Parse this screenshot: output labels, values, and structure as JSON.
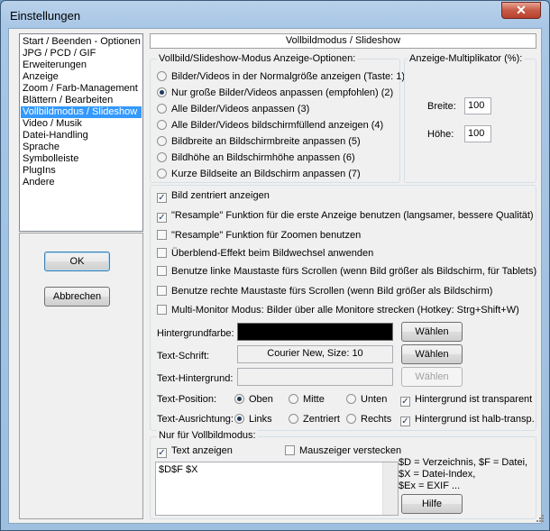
{
  "window": {
    "title": "Einstellungen",
    "close": "✕"
  },
  "nav": {
    "items": [
      "Start / Beenden - Optionen",
      "JPG / PCD / GIF",
      "Erweiterungen",
      "Anzeige",
      "Zoom / Farb-Management",
      "Blättern / Bearbeiten",
      "Vollbildmodus / Slideshow",
      "Video / Musik",
      "Datei-Handling",
      "Sprache",
      "Symbolleiste",
      "PlugIns",
      "Andere"
    ],
    "selected_index": 6
  },
  "buttons": {
    "ok": "OK",
    "cancel": "Abbrechen",
    "help": "Hilfe",
    "choose": "Wählen"
  },
  "header": "Vollbildmodus / Slideshow",
  "display_mode": {
    "label": "Vollbild/Slideshow-Modus Anzeige-Optionen:",
    "options": [
      "Bilder/Videos in der Normalgröße anzeigen (Taste: 1)",
      "Nur große Bilder/Videos anpassen (empfohlen) (2)",
      "Alle Bilder/Videos anpassen (3)",
      "Alle Bilder/Videos bildschirmfüllend anzeigen (4)",
      "Bildbreite an Bildschirmbreite anpassen (5)",
      "Bildhöhe an Bildschirmhöhe anpassen (6)",
      "Kurze Bildseite an Bildschirm anpassen (7)"
    ],
    "selected_index": 1
  },
  "multiplier": {
    "label": "Anzeige-Multiplikator (%):",
    "width_label": "Breite:",
    "width_value": "100",
    "height_label": "Höhe:",
    "height_value": "100"
  },
  "checkboxes": [
    {
      "label": "Bild zentriert anzeigen",
      "checked": true
    },
    {
      "label": "\"Resample\" Funktion für die erste Anzeige benutzen (langsamer, bessere Qualität)",
      "checked": true
    },
    {
      "label": "\"Resample\" Funktion für Zoomen benutzen",
      "checked": false
    },
    {
      "label": "Überblend-Effekt beim Bildwechsel anwenden",
      "checked": false
    },
    {
      "label": "Benutze linke Maustaste fürs Scrollen (wenn Bild größer als Bildschirm, für Tablets)",
      "checked": false
    },
    {
      "label": "Benutze rechte Maustaste fürs Scrollen (wenn Bild größer als Bildschirm)",
      "checked": false
    },
    {
      "label": "Multi-Monitor Modus: Bilder über alle Monitore strecken (Hotkey: Strg+Shift+W)",
      "checked": false
    }
  ],
  "background_color": {
    "label": "Hintergrundfarbe:",
    "value": "#000000"
  },
  "text_font": {
    "label": "Text-Schrift:",
    "value": "Courier New, Size: 10"
  },
  "text_background": {
    "label": "Text-Hintergrund:"
  },
  "text_position": {
    "label": "Text-Position:",
    "options": [
      "Oben",
      "Mitte",
      "Unten"
    ],
    "selected_index": 0
  },
  "text_alignment": {
    "label": "Text-Ausrichtung:",
    "options": [
      "Links",
      "Zentriert",
      "Rechts"
    ],
    "selected_index": 0
  },
  "bg_transparent": {
    "label": "Hintergrund ist transparent",
    "checked": true
  },
  "bg_semi": {
    "label": "Hintergrund ist halb-transp.",
    "checked": true
  },
  "fullscreen_only": {
    "label": "Nur für Vollbildmodus:",
    "show_text": {
      "label": "Text anzeigen",
      "checked": true
    },
    "hide_cursor": {
      "label": "Mauszeiger verstecken",
      "checked": false
    },
    "text_value": "$D$F $X",
    "tokens": [
      "$D = Verzeichnis, $F = Datei,",
      "$X = Datei-Index,",
      "$Ex = EXIF ..."
    ]
  }
}
